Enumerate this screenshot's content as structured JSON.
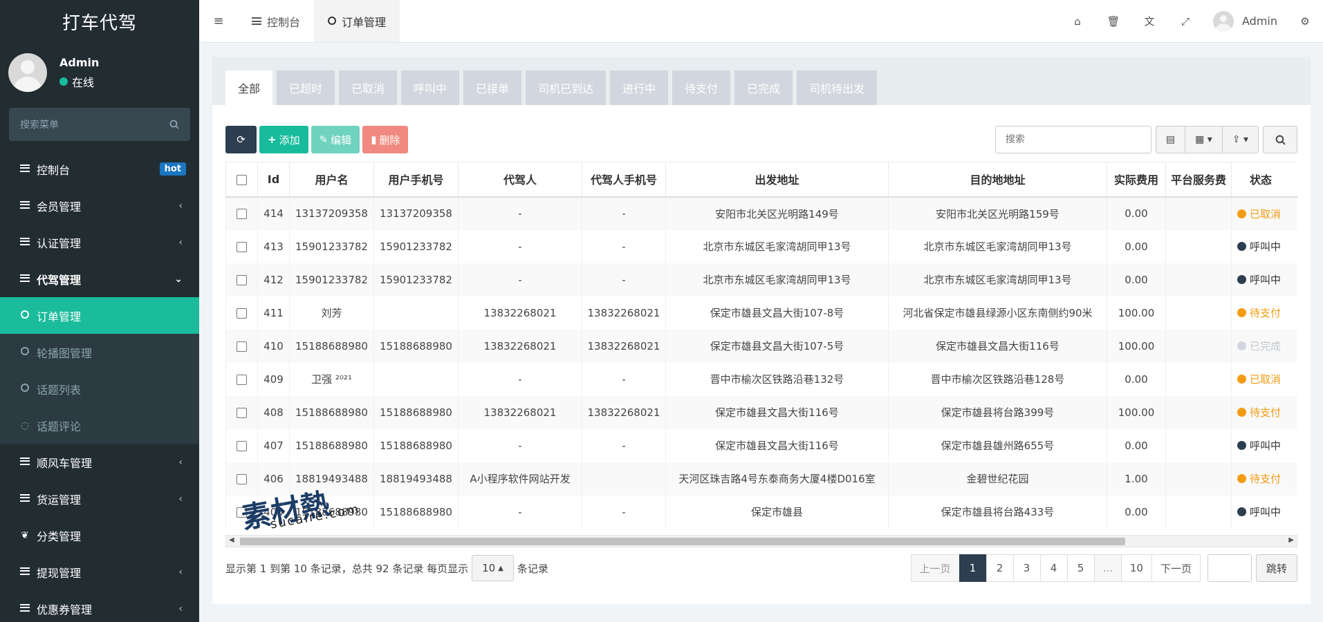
{
  "sidebar": {
    "brand": "打车代驾",
    "user_name": "Admin",
    "user_status": "在线",
    "search_placeholder": "搜索菜单",
    "items": [
      {
        "label": "控制台",
        "badge": "hot"
      },
      {
        "label": "会员管理"
      },
      {
        "label": "认证管理"
      },
      {
        "label": "代驾管理"
      },
      {
        "label": "订单管理"
      },
      {
        "label": "轮播图管理"
      },
      {
        "label": "话题列表"
      },
      {
        "label": "话题评论"
      },
      {
        "label": "顺风车管理"
      },
      {
        "label": "货运管理"
      },
      {
        "label": "分类管理"
      },
      {
        "label": "提现管理"
      },
      {
        "label": "优惠券管理"
      }
    ]
  },
  "topbar": {
    "tabs": [
      {
        "label": "控制台"
      },
      {
        "label": "订单管理"
      }
    ],
    "user": "Admin"
  },
  "status_tabs": [
    "全部",
    "已超时",
    "已取消",
    "呼叫中",
    "已接单",
    "司机已到达",
    "进行中",
    "待支付",
    "已完成",
    "司机待出发"
  ],
  "toolbar": {
    "add": "添加",
    "edit": "编辑",
    "delete": "删除",
    "search_placeholder": "搜索"
  },
  "table": {
    "headers": [
      "Id",
      "用户名",
      "用户手机号",
      "代驾人",
      "代驾人手机号",
      "出发地址",
      "目的地地址",
      "实际费用",
      "平台服务费",
      "状态"
    ],
    "rows": [
      {
        "id": "414",
        "username": "13137209358",
        "phone": "13137209358",
        "driver": "-",
        "driver_phone": "-",
        "from": "安阳市北关区光明路149号",
        "to": "安阳市北关区光明路159号",
        "fee": "0.00",
        "service_fee": "",
        "status": "已取消",
        "status_class": "st-cancel"
      },
      {
        "id": "413",
        "username": "15901233782",
        "phone": "15901233782",
        "driver": "-",
        "driver_phone": "-",
        "from": "北京市东城区毛家湾胡同甲13号",
        "to": "北京市东城区毛家湾胡同甲13号",
        "fee": "0.00",
        "service_fee": "",
        "status": "呼叫中",
        "status_class": "st-call"
      },
      {
        "id": "412",
        "username": "15901233782",
        "phone": "15901233782",
        "driver": "-",
        "driver_phone": "-",
        "from": "北京市东城区毛家湾胡同甲13号",
        "to": "北京市东城区毛家湾胡同甲13号",
        "fee": "0.00",
        "service_fee": "",
        "status": "呼叫中",
        "status_class": "st-call"
      },
      {
        "id": "411",
        "username": "刘芳",
        "phone": "",
        "driver": "13832268021",
        "driver_phone": "13832268021",
        "from": "保定市雄县文昌大街107-8号",
        "to": "河北省保定市雄县绿源小区东南侧约90米",
        "fee": "100.00",
        "service_fee": "",
        "status": "待支付",
        "status_class": "st-pay"
      },
      {
        "id": "410",
        "username": "15188688980",
        "phone": "15188688980",
        "driver": "13832268021",
        "driver_phone": "13832268021",
        "from": "保定市雄县文昌大街107-5号",
        "to": "保定市雄县文昌大街116号",
        "fee": "100.00",
        "service_fee": "",
        "status": "已完成",
        "status_class": "st-done"
      },
      {
        "id": "409",
        "username": "卫强 ²⁰²¹",
        "phone": "",
        "driver": "-",
        "driver_phone": "-",
        "from": "晋中市榆次区铁路沿巷132号",
        "to": "晋中市榆次区铁路沿巷128号",
        "fee": "0.00",
        "service_fee": "",
        "status": "已取消",
        "status_class": "st-cancel"
      },
      {
        "id": "408",
        "username": "15188688980",
        "phone": "15188688980",
        "driver": "13832268021",
        "driver_phone": "13832268021",
        "from": "保定市雄县文昌大街116号",
        "to": "保定市雄县将台路399号",
        "fee": "100.00",
        "service_fee": "",
        "status": "待支付",
        "status_class": "st-pay"
      },
      {
        "id": "407",
        "username": "15188688980",
        "phone": "15188688980",
        "driver": "-",
        "driver_phone": "-",
        "from": "保定市雄县文昌大街116号",
        "to": "保定市雄县雄州路655号",
        "fee": "0.00",
        "service_fee": "",
        "status": "呼叫中",
        "status_class": "st-call"
      },
      {
        "id": "406",
        "username": "18819493488",
        "phone": "18819493488",
        "driver": "A小程序软件网站开发",
        "driver_phone": "",
        "from": "天河区珠吉路4号东泰商务大厦4楼D016室",
        "to": "金碧世纪花园",
        "fee": "1.00",
        "service_fee": "",
        "status": "待支付",
        "status_class": "st-pay"
      },
      {
        "id": "405",
        "username": "15188688980",
        "phone": "15188688980",
        "driver": "-",
        "driver_phone": "-",
        "from": "保定市雄县",
        "to": "保定市雄县将台路433号",
        "fee": "0.00",
        "service_fee": "",
        "status": "呼叫中",
        "status_class": "st-call"
      }
    ]
  },
  "footer": {
    "summary": "显示第 1 到第 10 条记录，总共 92 条记录 每页显示",
    "page_size": "10",
    "suffix": "条记录",
    "pages": [
      "上一页",
      "1",
      "2",
      "3",
      "4",
      "5",
      "...",
      "10",
      "下一页"
    ],
    "current_page": "1",
    "jump": "跳转"
  },
  "watermark": {
    "logo": "素材熱",
    "url": "sucaire.com"
  }
}
